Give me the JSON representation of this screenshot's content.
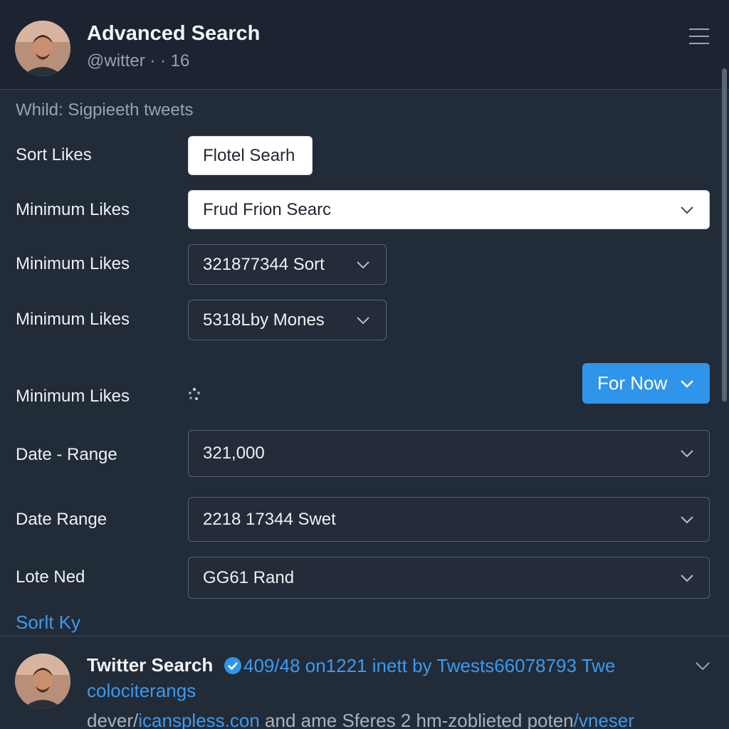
{
  "header": {
    "title": "Advanced Search",
    "subtitle": "@witter · · 16",
    "avatar_icon": "user-avatar",
    "menu_icon": "hamburger-menu-icon"
  },
  "form": {
    "intro": "Whild: Sigpieeth tweets",
    "rows": [
      {
        "label": "Sort Likes",
        "value": "Flotel Searh"
      },
      {
        "label": "Minimum Likes",
        "value": "Frud Frion Searc"
      },
      {
        "label": "Minimum Likes",
        "value": "321877344  Sort"
      },
      {
        "label": "Minimum Likes",
        "value": "5318Lby Mones"
      },
      {
        "label": "Minimum Likes",
        "value": ""
      },
      {
        "label": "Date - Range",
        "value": "321,000"
      },
      {
        "label": "Date Range",
        "value": "2218 17344  Swet"
      },
      {
        "label": "Lote Ned",
        "value": "GG61 Rand"
      }
    ],
    "primary_button": "For Now",
    "link": "Sorlt Ky"
  },
  "result": {
    "name": "Twitter Search",
    "meta": "409/48 on1221 inett by Twests66078793  Twe",
    "sub": "colociterangs",
    "body_prefix": "dever/",
    "body_link1": "icanspless.con",
    "body_middle": " and ame  Sferes 2 hm-zoblieted poten",
    "body_link2": "/vneser"
  },
  "colors": {
    "background": "#222b38",
    "header": "#1b2430",
    "accent": "#2f95ea",
    "link": "#3b9aee"
  }
}
